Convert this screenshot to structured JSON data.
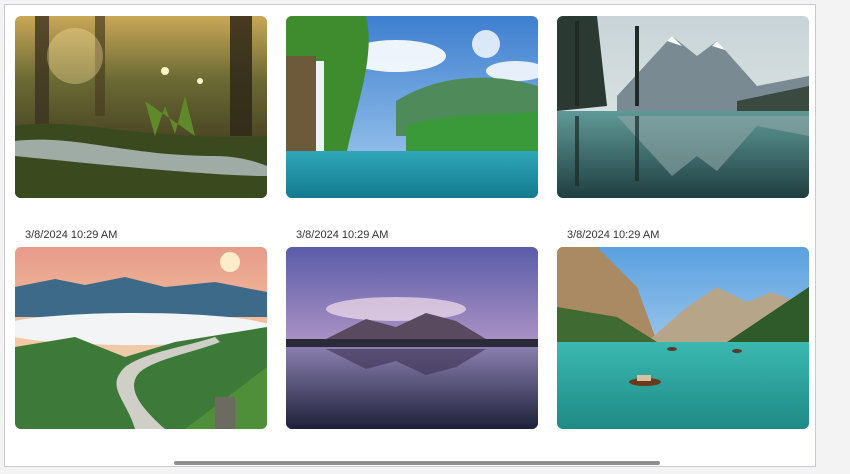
{
  "gallery": {
    "items": [
      {
        "scene": "forest-stream",
        "timestamp": ""
      },
      {
        "scene": "waterfall-lagoon",
        "timestamp": ""
      },
      {
        "scene": "mountain-lake-reflection",
        "timestamp": ""
      },
      {
        "scene": "misty-mountain-road",
        "timestamp": "3/8/2024 10:29 AM"
      },
      {
        "scene": "beach-mountain-sunset",
        "timestamp": "3/8/2024 10:29 AM"
      },
      {
        "scene": "alpine-lake-boat",
        "timestamp": "3/8/2024 10:29 AM"
      }
    ]
  },
  "colors": {
    "panel_border": "#c9c9d6",
    "scroll_thumb": "#8f8f8f"
  }
}
